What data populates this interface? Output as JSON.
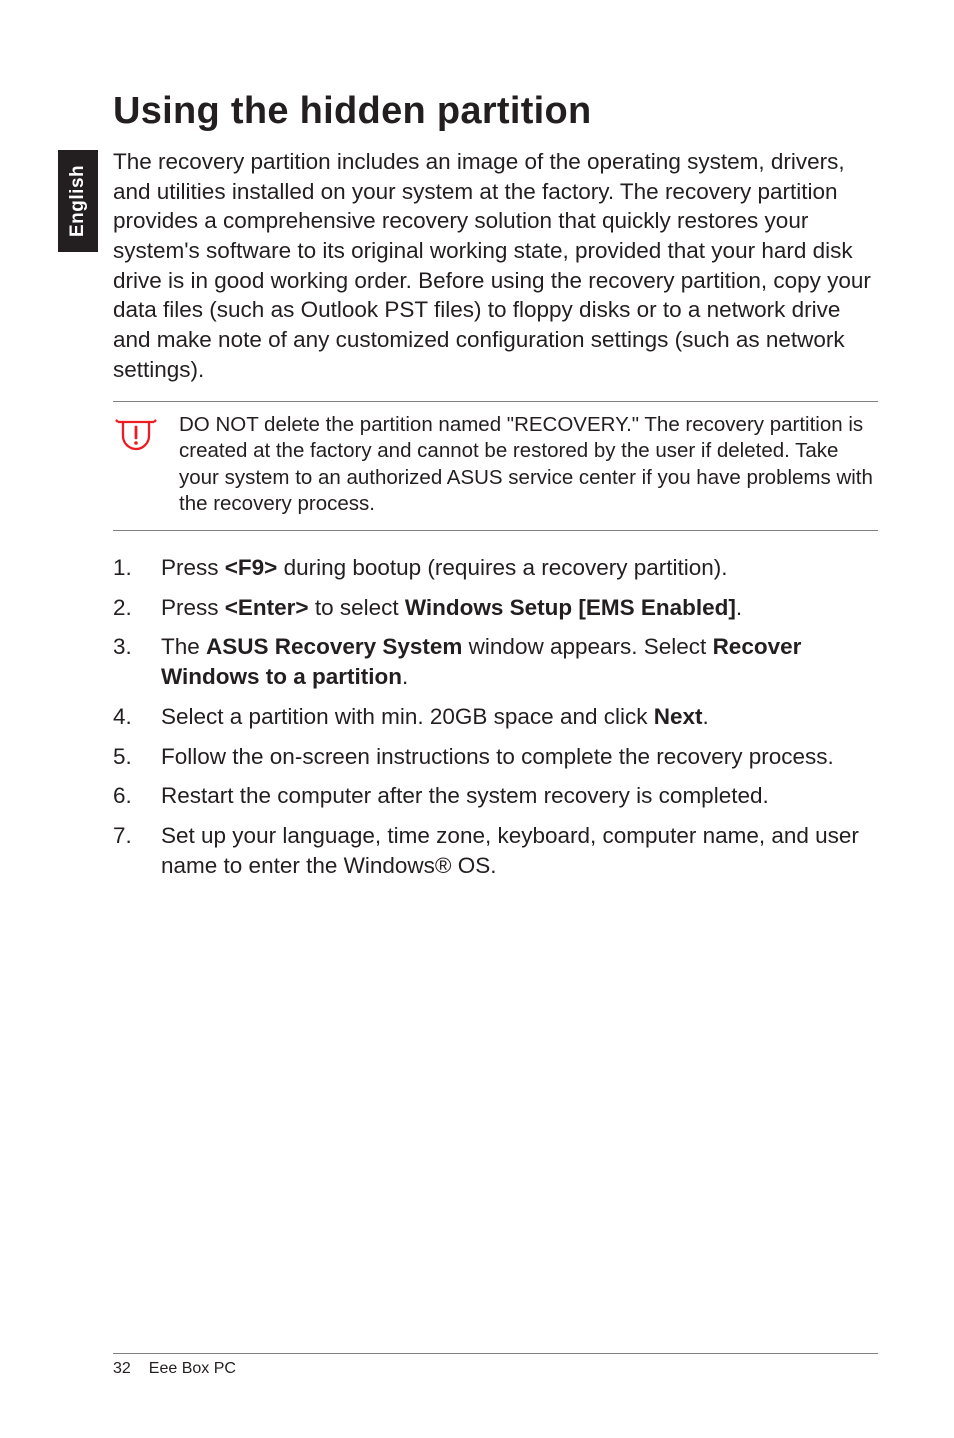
{
  "sideTab": "English",
  "heading": "Using the hidden partition",
  "intro": "The recovery partition includes an image of the operating system, drivers, and utilities installed on your system at the factory. The recovery partition provides a comprehensive recovery solution that quickly restores your system's software to its original working state, provided that your hard disk drive is in good working order. Before using the recovery partition, copy your data files (such as Outlook PST files) to floppy disks or to a network drive and make note of any customized configuration settings (such as network settings).",
  "warning": "DO NOT delete the partition named \"RECOVERY.\" The recovery partition is created at the factory and cannot be restored by the user if deleted. Take your system to an authorized ASUS service center if you have problems with the recovery process.",
  "steps": {
    "s1_a": "Press ",
    "s1_b": "<F9>",
    "s1_c": " during bootup (requires a recovery partition).",
    "s2_a": "Press ",
    "s2_b": "<Enter>",
    "s2_c": " to select ",
    "s2_d": "Windows Setup [EMS Enabled]",
    "s2_e": ".",
    "s3_a": "The ",
    "s3_b": "ASUS Recovery System",
    "s3_c": " window appears. Select ",
    "s3_d": "Recover Windows to a partition",
    "s3_e": ".",
    "s4_a": "Select a partition with min. 20GB space and click ",
    "s4_b": "Next",
    "s4_c": ".",
    "s5": "Follow the on-screen instructions to complete the recovery process.",
    "s6": "Restart the computer after the system recovery is completed.",
    "s7": "Set up your language, time zone, keyboard, computer name, and user name to enter the Windows® OS."
  },
  "footer": {
    "page": "32",
    "product": "Eee Box PC"
  }
}
